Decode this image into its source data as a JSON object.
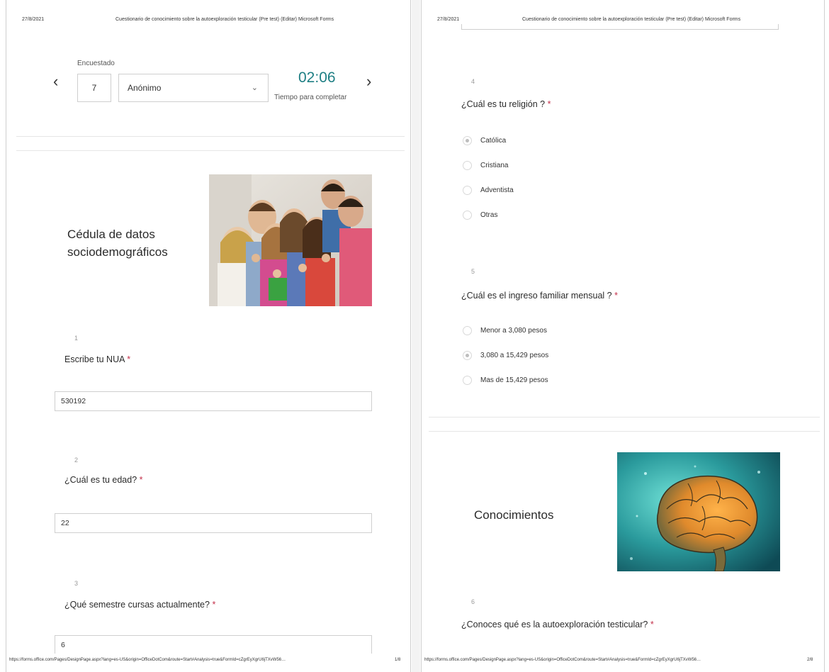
{
  "pages": [
    {
      "header_date": "27/8/2021",
      "header_title": "Cuestionario de conocimiento sobre la autoexploración testicular (Pre test) (Editar) Microsoft Forms",
      "footer_url": "https://forms.office.com/Pages/DesignPage.aspx?lang=es-US&origin=OfficeDotCom&route=Start#Analysis=true&FormId=cZgrEyXgrU6jTXvW56…",
      "footer_page": "1/8"
    },
    {
      "header_date": "27/8/2021",
      "header_title": "Cuestionario de conocimiento sobre la autoexploración testicular (Pre test) (Editar) Microsoft Forms",
      "footer_url": "https://forms.office.com/Pages/DesignPage.aspx?lang=es-US&origin=OfficeDotCom&route=Start#Analysis=true&FormId=cZgrEyXgrU6jTXvW56…",
      "footer_page": "2/8"
    }
  ],
  "respondent": {
    "label": "Encuestado",
    "number": "7",
    "name": "Anónimo",
    "time": "02:06",
    "time_label": "Tiempo para completar"
  },
  "sections": {
    "demographics_title": "Cédula de datos sociodemográficos",
    "knowledge_title": "Conocimientos"
  },
  "questions": [
    {
      "num": "1",
      "text": "Escribe tu NUA",
      "answer": "530192"
    },
    {
      "num": "2",
      "text": "¿Cuál es tu edad?",
      "answer": "22"
    },
    {
      "num": "3",
      "text": "¿Qué semestre cursas actualmente?",
      "answer": "6"
    },
    {
      "num": "4",
      "text": "¿Cuál es tu religión ?",
      "options": [
        "Católica",
        "Cristiana",
        "Adventista",
        "Otras"
      ],
      "selected": 0
    },
    {
      "num": "5",
      "text": "¿Cuál es el ingreso familiar mensual ?",
      "options": [
        "Menor a 3,080 pesos",
        "3,080 a 15,429 pesos",
        "Mas de 15,429 pesos"
      ],
      "selected": 1
    },
    {
      "num": "6",
      "text": "¿Conoces qué es la autoexploración testicular?"
    }
  ],
  "required_mark": "*",
  "icons": {
    "prev": "chevron-left-icon",
    "next": "chevron-right-icon",
    "dropdown": "chevron-down-icon"
  },
  "colors": {
    "accent": "#1f7f84",
    "required": "#c4314b"
  }
}
